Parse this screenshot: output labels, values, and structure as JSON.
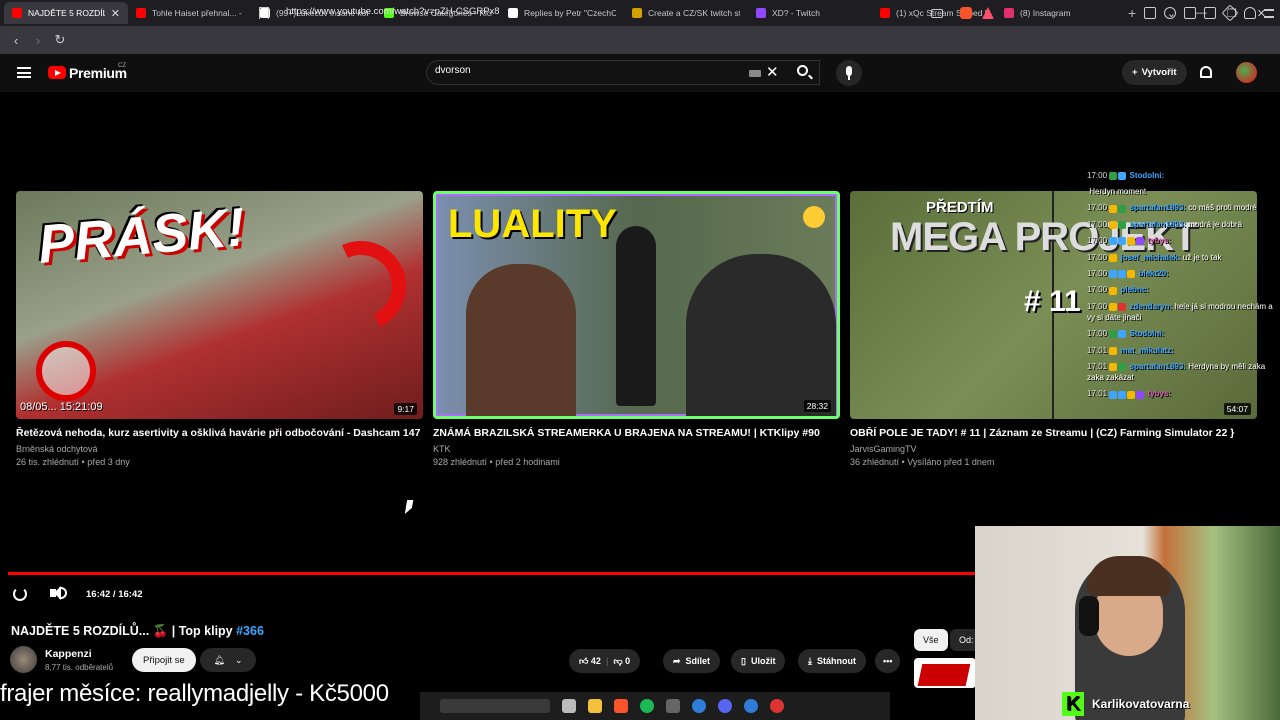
{
  "browser": {
    "tabs": [
      {
        "title": "NAJDĚTE 5 ROZDÍLŮ...",
        "color": "#ff0000",
        "active": true
      },
      {
        "title": "Tohle Haiset přehnal... - Y",
        "color": "#ff0000",
        "active": false
      },
      {
        "title": "(99+)Lukecův insane kom",
        "color": "#ffffff",
        "active": false
      },
      {
        "title": "Browse Categories - Kick",
        "color": "#53fc18",
        "active": false
      },
      {
        "title": "Replies by Petr \"CzechClo",
        "color": "#ffffff",
        "active": false
      },
      {
        "title": "Create a CZ/SK twitch stre",
        "color": "#d4a000",
        "active": false
      },
      {
        "title": "XD? - Twitch",
        "color": "#9146ff",
        "active": false
      },
      {
        "title": "(1) xQc Stream Sniped by",
        "color": "#ff0000",
        "active": false
      },
      {
        "title": "(8) Instagram",
        "color": "#e1306c",
        "active": false
      }
    ],
    "url": "https://www.youtube.com/watch?v=pZH-CSGRPx8"
  },
  "masthead": {
    "logo": "Premium",
    "logo_country": "CZ",
    "search_value": "dvorson",
    "create_label": "Vytvořit"
  },
  "endscreen": [
    {
      "thumb_text": "PRÁSK!",
      "stamp": "08/05...  15:21:09",
      "duration": "9:17",
      "title": "Řetězová nehoda, kurz asertivity a ošklivá havárie při odbočování - Dashcam 147",
      "channel": "Brněnská odchytová",
      "meta": "26 tis. zhlédnutí • před 3 dny"
    },
    {
      "thumb_text": "LUALITY",
      "duration": "28:32",
      "title": "ZNÁMÁ BRAZILSKÁ STREAMERKA U BRAJENA NA STREAMU! | KTKlipy #90",
      "channel": "KTK",
      "meta": "928 zhlédnutí • před 2 hodinami"
    },
    {
      "thumb_pre": "PŘEDTÍM",
      "thumb_text": "MEGA PROJEKT",
      "thumb_num": "# 11",
      "duration": "54:07",
      "title": "OBŘÍ POLE JE TADY! # 11 | Záznam ze Streamu | (CZ) Farming Simulator 22 }",
      "channel": "JarvisGamingTV",
      "meta": "36 zhlédnutí • Vysíláno před 1 dnem"
    }
  ],
  "chat": [
    {
      "time": "17:00",
      "user": "Stodolni:",
      "user_color": "#3ea6ff",
      "text": "",
      "badges": [
        "#2f9e44",
        "#3ea6ff"
      ]
    },
    {
      "time": "",
      "user": "",
      "user_color": "#ffffff",
      "text": "Herdyn moment",
      "badges": []
    },
    {
      "time": "17:00",
      "user": "spartafan1893:",
      "user_color": "#3ea6ff",
      "text": "co máš proti modré",
      "badges": [
        "#f5b800",
        "#2f9e44"
      ]
    },
    {
      "time": "17:00",
      "user": "spartafan1893:",
      "user_color": "#3ea6ff",
      "text": "modrá je dobrá",
      "badges": [
        "#f5b800",
        "#2f9e44"
      ]
    },
    {
      "time": "17:00",
      "user": "tybys:",
      "user_color": "#d65db1",
      "text": "",
      "badges": [
        "#3ea6ff",
        "#3ea6ff",
        "#f5b800",
        "#9146ff"
      ]
    },
    {
      "time": "17:00",
      "user": "josef_michalek:",
      "user_color": "#3ea6ff",
      "text": "už je to tak",
      "badges": [
        "#f5b800"
      ]
    },
    {
      "time": "17:00",
      "user": "blekt20:",
      "user_color": "#3ea6ff",
      "text": "",
      "badges": [
        "#3ea6ff",
        "#3ea6ff",
        "#f5b800"
      ]
    },
    {
      "time": "17:00",
      "user": "plebnc:",
      "user_color": "#3ea6ff",
      "text": "",
      "badges": [
        "#f5b800"
      ]
    },
    {
      "time": "17:00",
      "user": "zdendaryn:",
      "user_color": "#3ea6ff",
      "text": "hele já si modrou nechám a vy si dáte jinači",
      "badges": [
        "#f5b800",
        "#e03131"
      ]
    },
    {
      "time": "17:00",
      "user": "Stodolni:",
      "user_color": "#3ea6ff",
      "text": "",
      "badges": [
        "#2f9e44",
        "#3ea6ff"
      ]
    },
    {
      "time": "17:01",
      "user": "mat_mikulatz:",
      "user_color": "#3ea6ff",
      "text": "",
      "badges": [
        "#f5b800"
      ]
    },
    {
      "time": "17:01",
      "user": "spartafan1893:",
      "user_color": "#3ea6ff",
      "text": "Herdyna by měli zaka zaka zakázat",
      "badges": [
        "#f5b800",
        "#2f9e44"
      ]
    },
    {
      "time": "17:01",
      "user": "tybys:",
      "user_color": "#d65db1",
      "text": "",
      "badges": [
        "#3ea6ff",
        "#3ea6ff",
        "#f5b800",
        "#9146ff"
      ]
    }
  ],
  "player": {
    "time": "16:42 / 16:42",
    "progress": 1.0
  },
  "watch": {
    "title": "NAJDĚTE 5 ROZDÍLŮ... 🍒 | Top klipy",
    "title_hash": "#366",
    "channel": "Kappenzi",
    "subs": "8,77 tis. odběratelů",
    "join": "Připojit se",
    "likes": "42",
    "dislikes": "0",
    "share": "Sdílet",
    "save": "Uložit",
    "download": "Stáhnout",
    "chip_all": "Vše",
    "chip_from": "Od:"
  },
  "overlay": {
    "donation": "frajer měsíce: reallymadjelly - Kč5000",
    "cam_name": "Karlikovatovarna"
  }
}
